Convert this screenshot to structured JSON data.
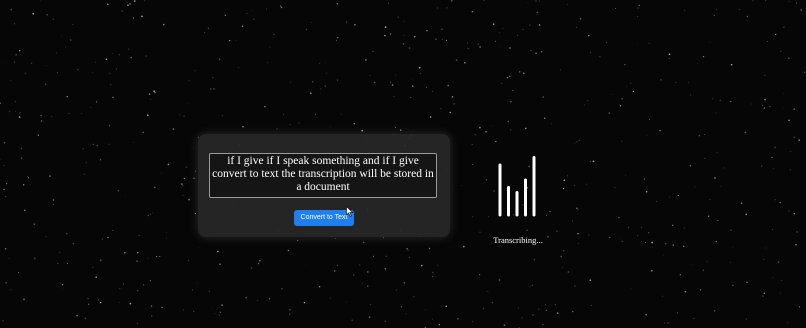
{
  "transcript": {
    "text": "if I give if I speak something and if I give convert to text the transcription will be stored in a document"
  },
  "convert_button": {
    "label": "Convert to Text"
  },
  "status": {
    "label": "Transcribing..."
  },
  "visualizer": {
    "icon": "audio-waveform-icon",
    "levels": [
      1.0,
      0.55,
      0.45,
      0.7,
      1.15
    ]
  },
  "colors": {
    "background": "#060606",
    "panel": "#282828",
    "accent": "#1f7fee",
    "text": "#ffffff"
  }
}
